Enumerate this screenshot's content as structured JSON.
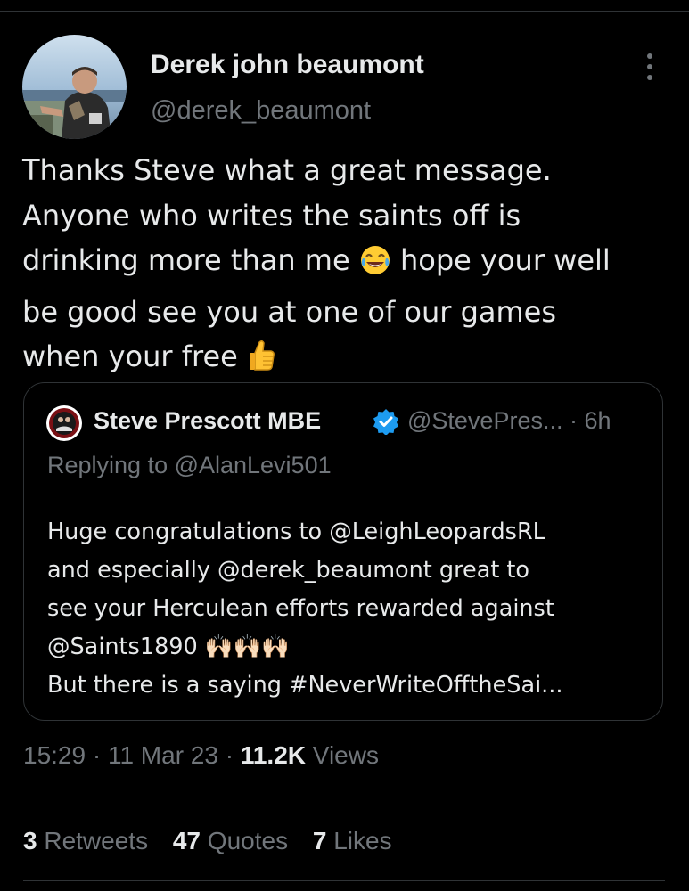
{
  "tweet": {
    "author": {
      "name": "Derek john beaumont",
      "handle": "@derek_beaumont",
      "avatar_icon": "profile-photo"
    },
    "text": {
      "line1": "Thanks Steve what a great message.",
      "line2": "Anyone who writes the saints off is",
      "line3_a": "drinking more than me ",
      "line3_emoji": "😂",
      "line3_b": " hope your well",
      "line4": "be good see you at one of our games",
      "line5_a": "when your free ",
      "line5_emoji": "👍"
    },
    "timestamp": "15:29 · 11 Mar 23 · ",
    "views_count": "11.2K",
    "views_label": " Views"
  },
  "quote": {
    "author_name": "Steve Prescott MBE",
    "meta": "@StevePres... · 6h",
    "replying_to": "Replying to @AlanLevi501",
    "text": {
      "line1": "Huge congratulations to @LeighLeopardsRL",
      "line2": "and especially @derek_beaumont great to",
      "line3": "see your Herculean efforts rewarded against",
      "line4": "@Saints1890 🙌🏻🙌🏻🙌🏻",
      "line5": "But there is a saying #NeverWriteOfftheSai..."
    }
  },
  "stats": {
    "retweets_count": "3",
    "retweets_label": " Retweets",
    "quotes_count": "47",
    "quotes_label": " Quotes",
    "likes_count": "7",
    "likes_label": " Likes"
  },
  "colors": {
    "background": "#000000",
    "text_primary": "#e7e9ea",
    "text_secondary": "#71767b",
    "divider": "#2f3336",
    "verified": "#1d9bf0"
  }
}
